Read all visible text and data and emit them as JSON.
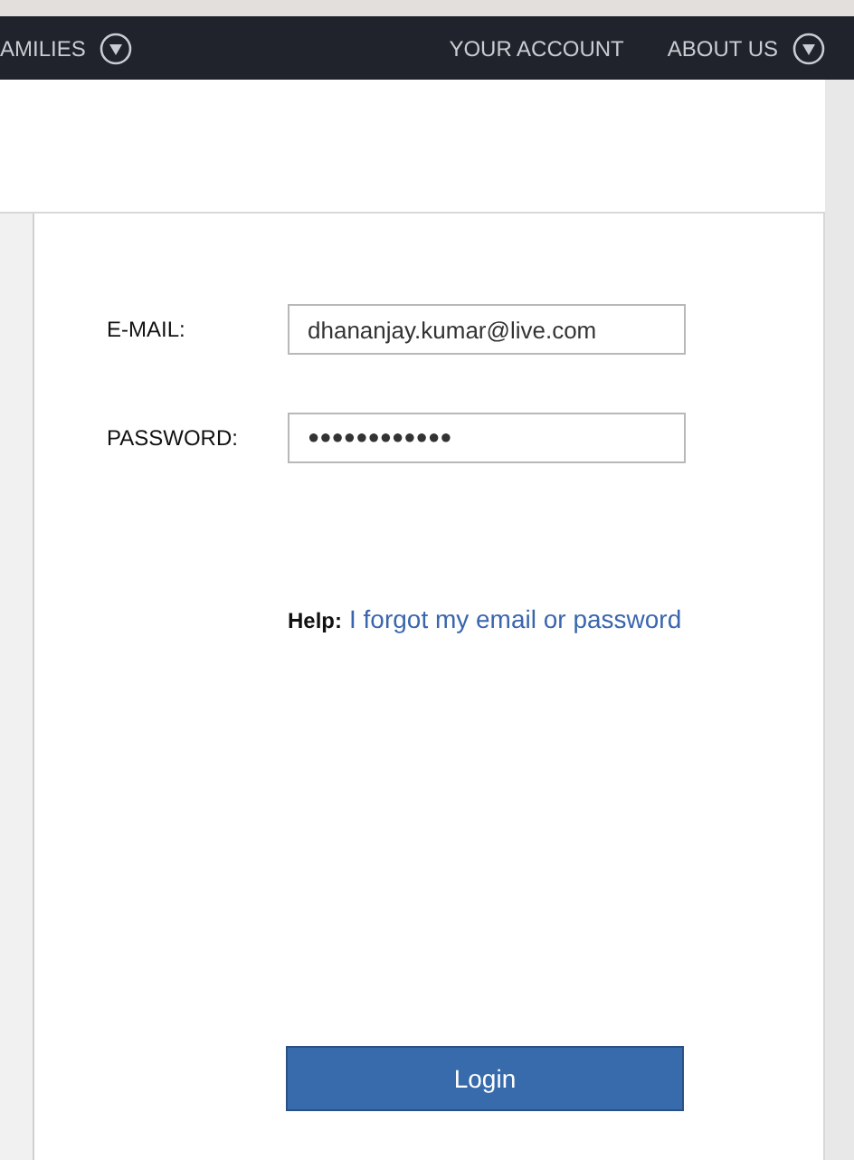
{
  "nav": {
    "left_items": [
      {
        "label": "AMILIES",
        "has_menu": true
      }
    ],
    "right_items": [
      {
        "label": "YOUR ACCOUNT",
        "has_menu": false
      },
      {
        "label": "ABOUT US",
        "has_menu": true
      }
    ]
  },
  "form": {
    "fields": [
      {
        "label": "E-MAIL:",
        "value": "dhananjay.kumar@live.com",
        "kind": "text"
      },
      {
        "label": "PASSWORD:",
        "value": "●●●●●●●●●●●●",
        "kind": "password"
      }
    ],
    "help": {
      "label": "Help:",
      "link": "I forgot my email or password"
    },
    "submit": "Login"
  }
}
